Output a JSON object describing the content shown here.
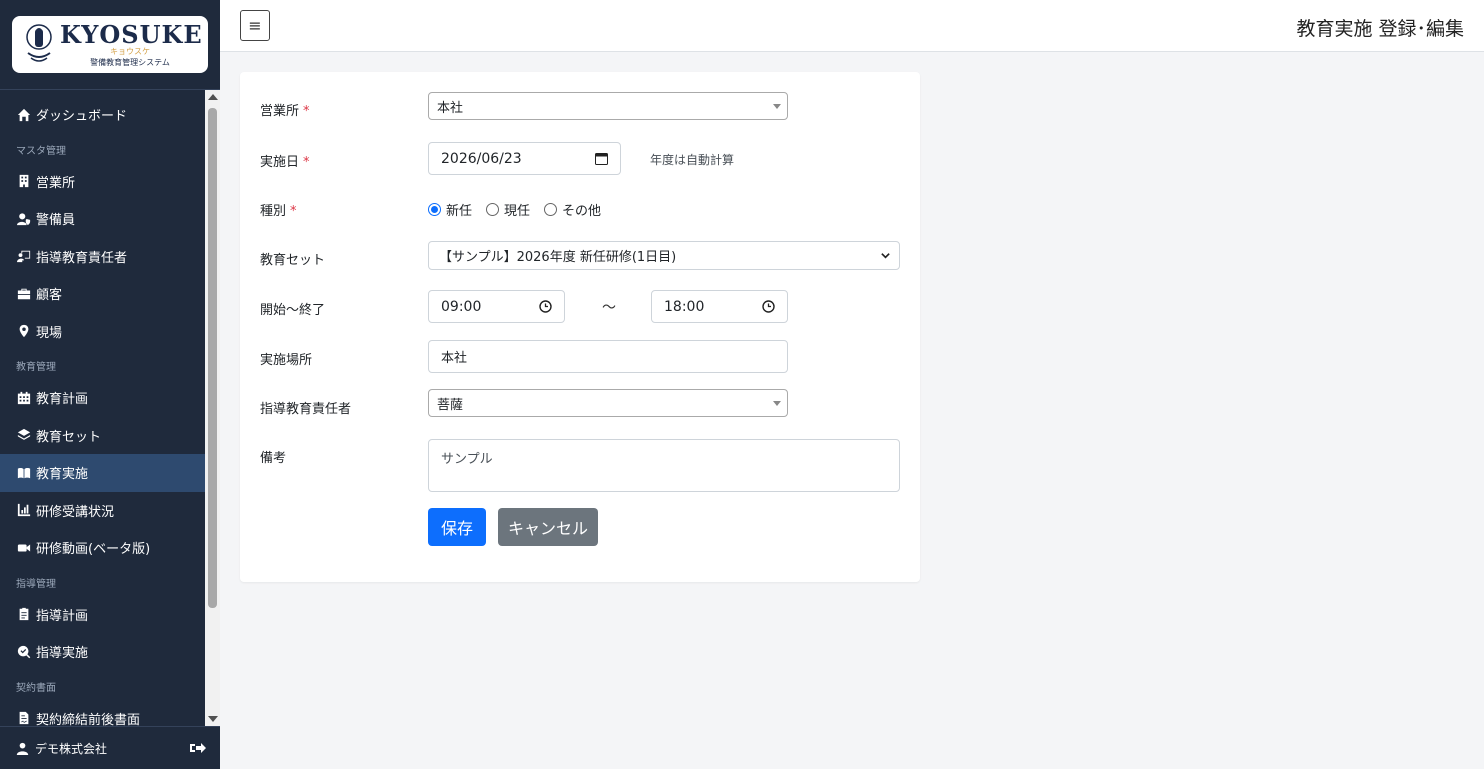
{
  "logo": {
    "title": "KYOSUKE",
    "kana": "キョウスケ",
    "subtitle": "警備教育管理システム"
  },
  "sidebar": {
    "items": [
      {
        "type": "item",
        "label": "ダッシュボード",
        "icon": "home-icon"
      },
      {
        "type": "section",
        "label": "マスタ管理"
      },
      {
        "type": "item",
        "label": "営業所",
        "icon": "building-icon"
      },
      {
        "type": "item",
        "label": "警備員",
        "icon": "user-shield-icon"
      },
      {
        "type": "item",
        "label": "指導教育責任者",
        "icon": "chalkboard-teacher-icon"
      },
      {
        "type": "item",
        "label": "顧客",
        "icon": "briefcase-icon"
      },
      {
        "type": "item",
        "label": "現場",
        "icon": "map-marker-icon"
      },
      {
        "type": "section",
        "label": "教育管理"
      },
      {
        "type": "item",
        "label": "教育計画",
        "icon": "calendar-icon"
      },
      {
        "type": "item",
        "label": "教育セット",
        "icon": "layers-icon"
      },
      {
        "type": "item",
        "label": "教育実施",
        "icon": "book-open-icon",
        "active": true
      },
      {
        "type": "item",
        "label": "研修受講状況",
        "icon": "chart-bar-icon"
      },
      {
        "type": "item",
        "label": "研修動画(ベータ版)",
        "icon": "video-icon"
      },
      {
        "type": "section",
        "label": "指導管理"
      },
      {
        "type": "item",
        "label": "指導計画",
        "icon": "clipboard-icon"
      },
      {
        "type": "item",
        "label": "指導実施",
        "icon": "search-check-icon"
      },
      {
        "type": "section",
        "label": "契約書面"
      },
      {
        "type": "item",
        "label": "契約締結前後書面",
        "icon": "file-contract-icon"
      }
    ],
    "footer_user": "デモ株式会社"
  },
  "header": {
    "menu_icon": "≡",
    "title": "教育実施 登録･編集"
  },
  "form": {
    "office": {
      "label": "営業所",
      "value": "本社"
    },
    "date": {
      "label": "実施日",
      "value": "2026/06/23",
      "hint": "年度は自動計算"
    },
    "category": {
      "label": "種別",
      "options": [
        "新任",
        "現任",
        "その他"
      ],
      "selected": "新任"
    },
    "set": {
      "label": "教育セット",
      "value": "【サンプル】2026年度 新任研修(1日目)"
    },
    "time": {
      "label": "開始～終了",
      "start": "09:00",
      "separator": "～",
      "end": "18:00"
    },
    "place": {
      "label": "実施場所",
      "value": "本社"
    },
    "instructor": {
      "label": "指導教育責任者",
      "value": "菩薩"
    },
    "notes": {
      "label": "備考",
      "value": "サンプル"
    },
    "required_mark": "*",
    "save_label": "保存",
    "cancel_label": "キャンセル"
  },
  "colors": {
    "sidebar_bg": "#1f2a3c",
    "active_bg": "#2e4a6f",
    "primary": "#0d6efd",
    "secondary": "#6c757d",
    "required": "#dc3545"
  }
}
